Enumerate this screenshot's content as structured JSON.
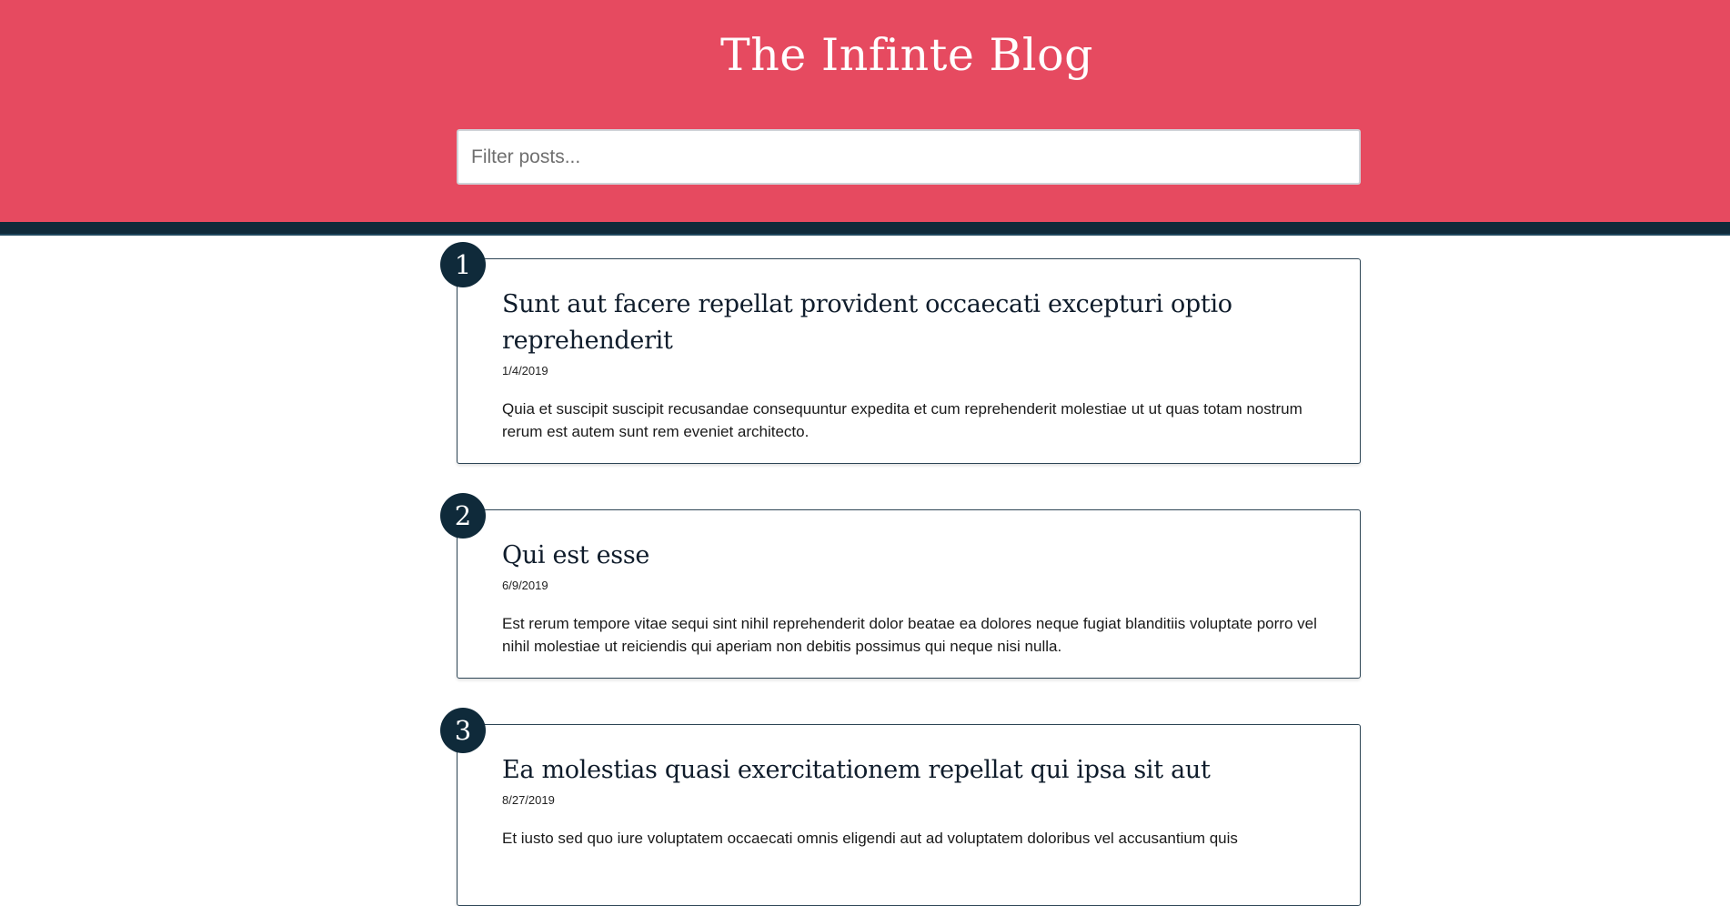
{
  "header": {
    "title": "The Infinte Blog",
    "filter_placeholder": "Filter posts..."
  },
  "posts": [
    {
      "number": "1",
      "title": "Sunt aut facere repellat provident occaecati excepturi optio reprehenderit",
      "date": "1/4/2019",
      "body": "Quia et suscipit suscipit recusandae consequuntur expedita et cum reprehenderit molestiae ut ut quas totam nostrum rerum est autem sunt rem eveniet architecto."
    },
    {
      "number": "2",
      "title": "Qui est esse",
      "date": "6/9/2019",
      "body": "Est rerum tempore vitae sequi sint nihil reprehenderit dolor beatae ea dolores neque fugiat blanditiis voluptate porro vel nihil molestiae ut reiciendis qui aperiam non debitis possimus qui neque nisi nulla."
    },
    {
      "number": "3",
      "title": "Ea molestias quasi exercitationem repellat qui ipsa sit aut",
      "date": "8/27/2019",
      "body": "Et iusto sed quo iure voluptatem occaecati omnis eligendi aut ad voluptatem doloribus vel accusantium quis"
    }
  ],
  "colors": {
    "header_background": "#e64a60",
    "accent_dark": "#0f2a3a",
    "page_background": "#ffffff"
  }
}
